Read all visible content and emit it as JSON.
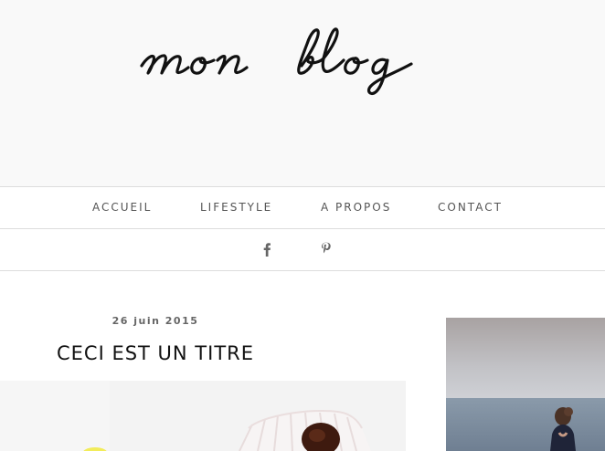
{
  "header": {
    "logo_text": "mon blog"
  },
  "nav": {
    "items": [
      {
        "label": "ACCUEIL"
      },
      {
        "label": "LIFESTYLE"
      },
      {
        "label": "A PROPOS"
      },
      {
        "label": "CONTACT"
      }
    ]
  },
  "social": {
    "icons": [
      "facebook-icon",
      "pinterest-icon"
    ]
  },
  "post": {
    "date": "26 juin 2015",
    "title": "CECI EST UN TITRE"
  },
  "colors": {
    "header_bg": "#f9f9f9",
    "border": "#dddddd",
    "nav_text": "#555555",
    "title_text": "#111111"
  }
}
